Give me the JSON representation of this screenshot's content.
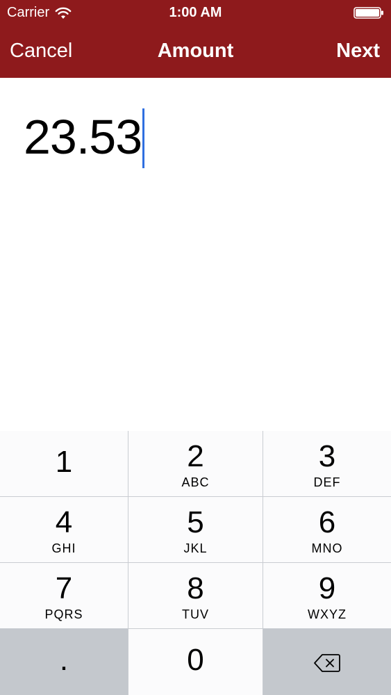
{
  "status_bar": {
    "carrier": "Carrier",
    "time": "1:00 AM",
    "wifi_icon": "wifi-icon",
    "battery_icon": "battery-full-icon"
  },
  "nav": {
    "cancel_label": "Cancel",
    "title": "Amount",
    "next_label": "Next",
    "background_color": "#8e1a1c"
  },
  "amount": {
    "value": "23.53",
    "cursor_color": "#2f6fe0"
  },
  "keypad": {
    "keys": [
      {
        "digit": "1",
        "letters": ""
      },
      {
        "digit": "2",
        "letters": "ABC"
      },
      {
        "digit": "3",
        "letters": "DEF"
      },
      {
        "digit": "4",
        "letters": "GHI"
      },
      {
        "digit": "5",
        "letters": "JKL"
      },
      {
        "digit": "6",
        "letters": "MNO"
      },
      {
        "digit": "7",
        "letters": "PQRS"
      },
      {
        "digit": "8",
        "letters": "TUV"
      },
      {
        "digit": "9",
        "letters": "WXYZ"
      }
    ],
    "decimal_key": ".",
    "zero_key": "0",
    "delete_icon": "backspace-icon"
  }
}
